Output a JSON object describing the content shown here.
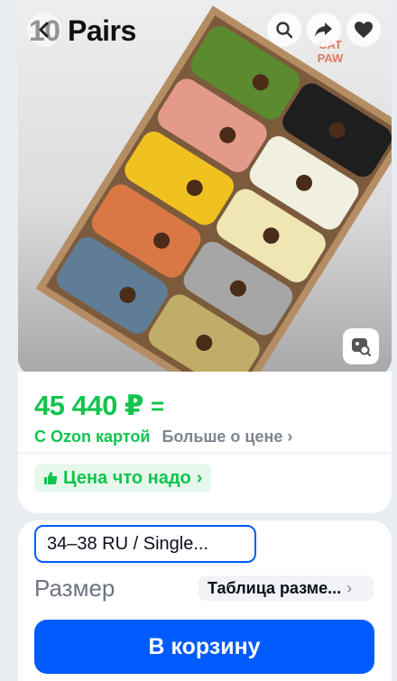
{
  "hero": {
    "title": "10 Pairs",
    "back_icon": "chevron-left-icon",
    "brand_mark_line1": "CAT",
    "brand_mark_line2": "PAW",
    "actions": [
      "search-icon",
      "share-icon",
      "heart-icon"
    ],
    "lens_icon": "image-search-icon"
  },
  "pricing": {
    "price": "45 440 ₽",
    "equal_sign": "=",
    "ozon_card_label": "С Ozon картой",
    "more_label": "Больше о цене",
    "more_chevron": "›",
    "good_price_label": "Цена что надо",
    "good_price_chevron": "›"
  },
  "size": {
    "selected": "34–38 RU / Single...",
    "label": "Размер",
    "table_label": "Таблица разме...",
    "table_chevron": "›"
  },
  "cart": {
    "label": "В корзину"
  },
  "colors": {
    "green": "#10c44c",
    "blue": "#005bff",
    "gray_text": "#7d8590",
    "background": "#e9edf2"
  }
}
